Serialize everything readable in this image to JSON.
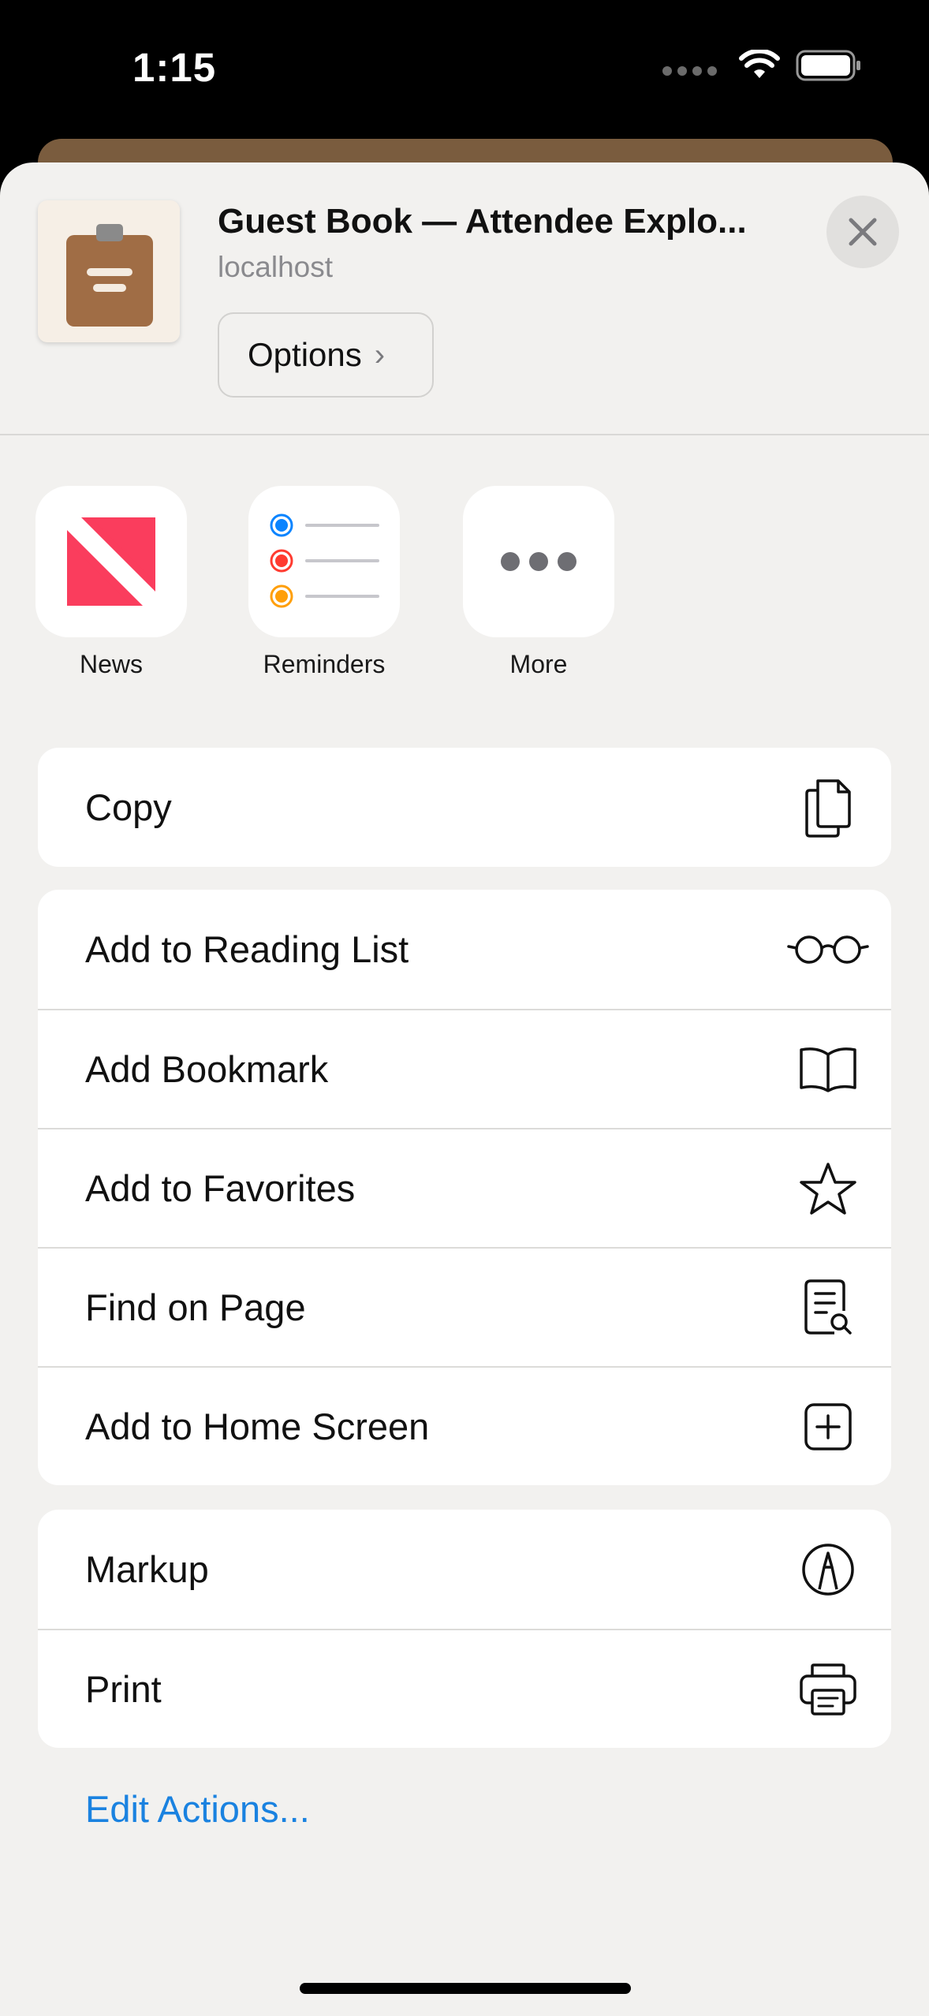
{
  "status_bar": {
    "time": "1:15"
  },
  "header": {
    "title": "Guest Book — Attendee Explo...",
    "subtitle": "localhost",
    "options_label": "Options",
    "options_chevron": "›"
  },
  "apps": [
    {
      "label": "News",
      "icon": "news-icon"
    },
    {
      "label": "Reminders",
      "icon": "reminders-icon"
    },
    {
      "label": "More",
      "icon": "more-icon"
    }
  ],
  "groups": {
    "copy": [
      {
        "label": "Copy",
        "icon": "copy-icon"
      }
    ],
    "page_actions": [
      {
        "label": "Add to Reading List",
        "icon": "glasses-icon"
      },
      {
        "label": "Add Bookmark",
        "icon": "book-icon"
      },
      {
        "label": "Add to Favorites",
        "icon": "star-icon"
      },
      {
        "label": "Find on Page",
        "icon": "find-doc-icon"
      },
      {
        "label": "Add to Home Screen",
        "icon": "plus-square-icon"
      }
    ],
    "tools": [
      {
        "label": "Markup",
        "icon": "markup-icon"
      },
      {
        "label": "Print",
        "icon": "printer-icon"
      }
    ]
  },
  "edit_actions_label": "Edit Actions...",
  "colors": {
    "accent": "#1a82e0",
    "sheet_bg": "#f2f1ef",
    "news_red": "#fa3d5d",
    "reminder_blue": "#0a84ff",
    "reminder_red": "#ff3b30",
    "reminder_orange": "#ff9f0a"
  }
}
